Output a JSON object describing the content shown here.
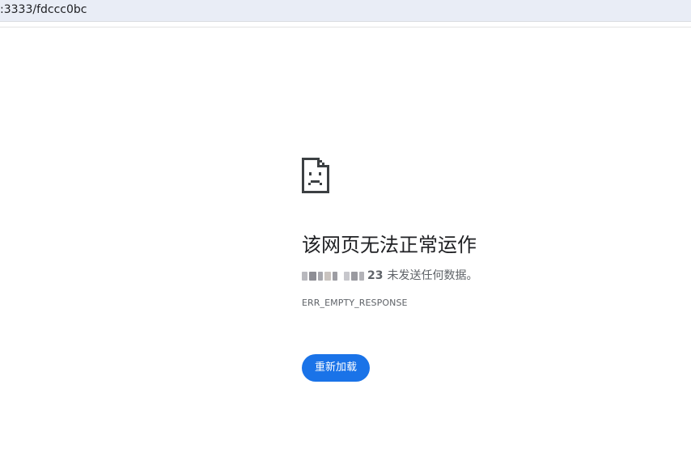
{
  "address_bar": {
    "url_text": ":3333/fdccc0bc"
  },
  "error_page": {
    "icon": "sad-page-icon",
    "title": "该网页无法正常运作",
    "host_visible_suffix": "23",
    "detail_text": "未发送任何数据。",
    "error_code": "ERR_EMPTY_RESPONSE",
    "reload_label": "重新加载"
  },
  "colors": {
    "accent": "#1a73e8",
    "address_bar_bg": "#e9edf6",
    "title": "#202124",
    "secondary_text": "#5f6368"
  }
}
